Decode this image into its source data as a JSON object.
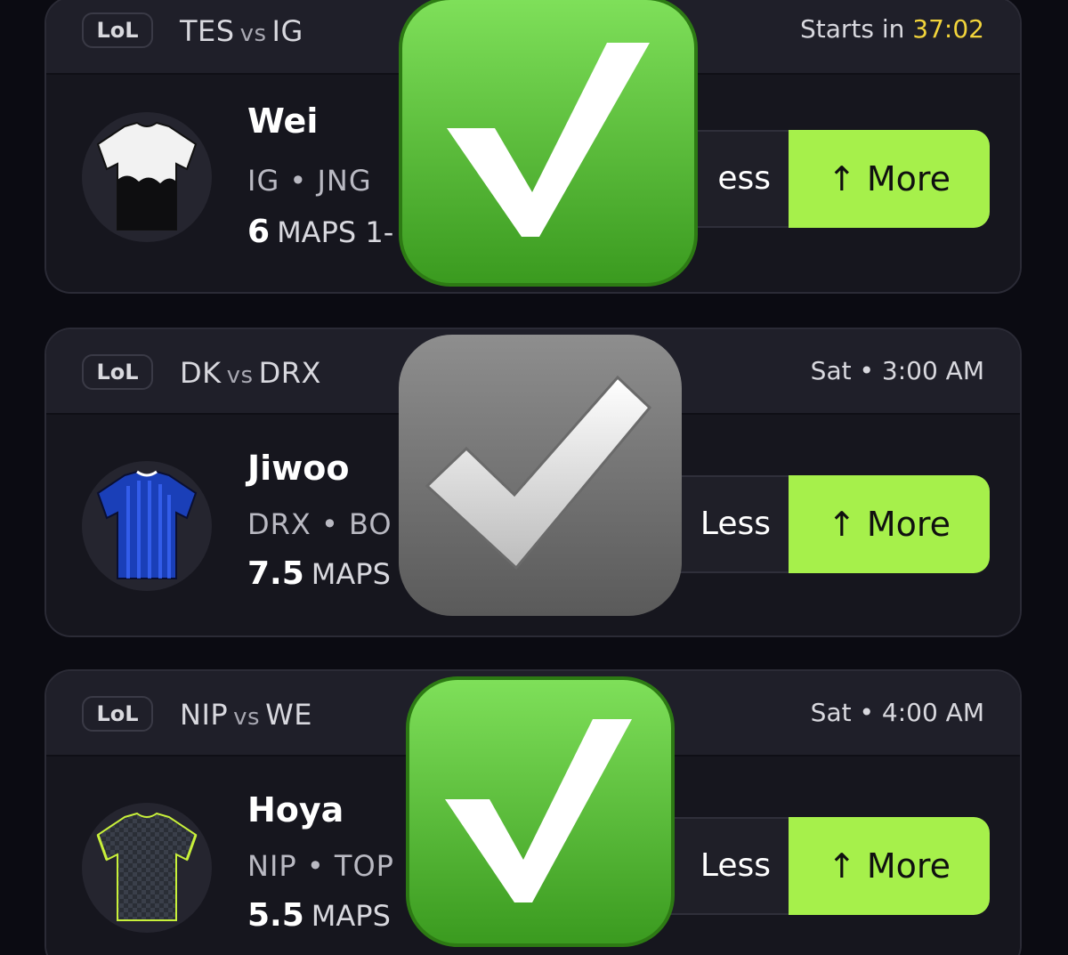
{
  "picks": [
    {
      "league": "LoL",
      "team_a": "TES",
      "vs": "vs",
      "team_b": "IG",
      "time_prefix": "Starts in ",
      "time_value": "37:02",
      "player": "Wei",
      "meta": "IG • JNG",
      "line": "6",
      "stat": "MAPS 1-",
      "less_label": "ess",
      "more_label": "More",
      "jersey_color": "#f2f2f2",
      "check_style": "green"
    },
    {
      "league": "LoL",
      "team_a": "DK",
      "vs": "vs",
      "team_b": "DRX",
      "time_prefix": "",
      "time_value": "Sat • 3:00 AM",
      "player": "Jiwoo",
      "meta": "DRX • BO",
      "line": "7.5",
      "stat": "MAPS",
      "less_label": "Less",
      "more_label": "More",
      "jersey_color": "#1a3fb8",
      "check_style": "grey"
    },
    {
      "league": "LoL",
      "team_a": "NIP",
      "vs": "vs",
      "team_b": "WE",
      "time_prefix": "",
      "time_value": "Sat • 4:00 AM",
      "player": "Hoya",
      "meta": "NIP • TOP",
      "line": "5.5",
      "stat": "MAPS",
      "less_label": "Less",
      "more_label": "More",
      "jersey_color": "#3a3f4a",
      "check_style": "green"
    }
  ],
  "icons": {
    "more_arrow": "↑",
    "checkmark": "check-mark-emoji"
  },
  "colors": {
    "more_button": "#a6f04b",
    "countdown": "#f2d43b",
    "check_green": "#4fb52a"
  }
}
